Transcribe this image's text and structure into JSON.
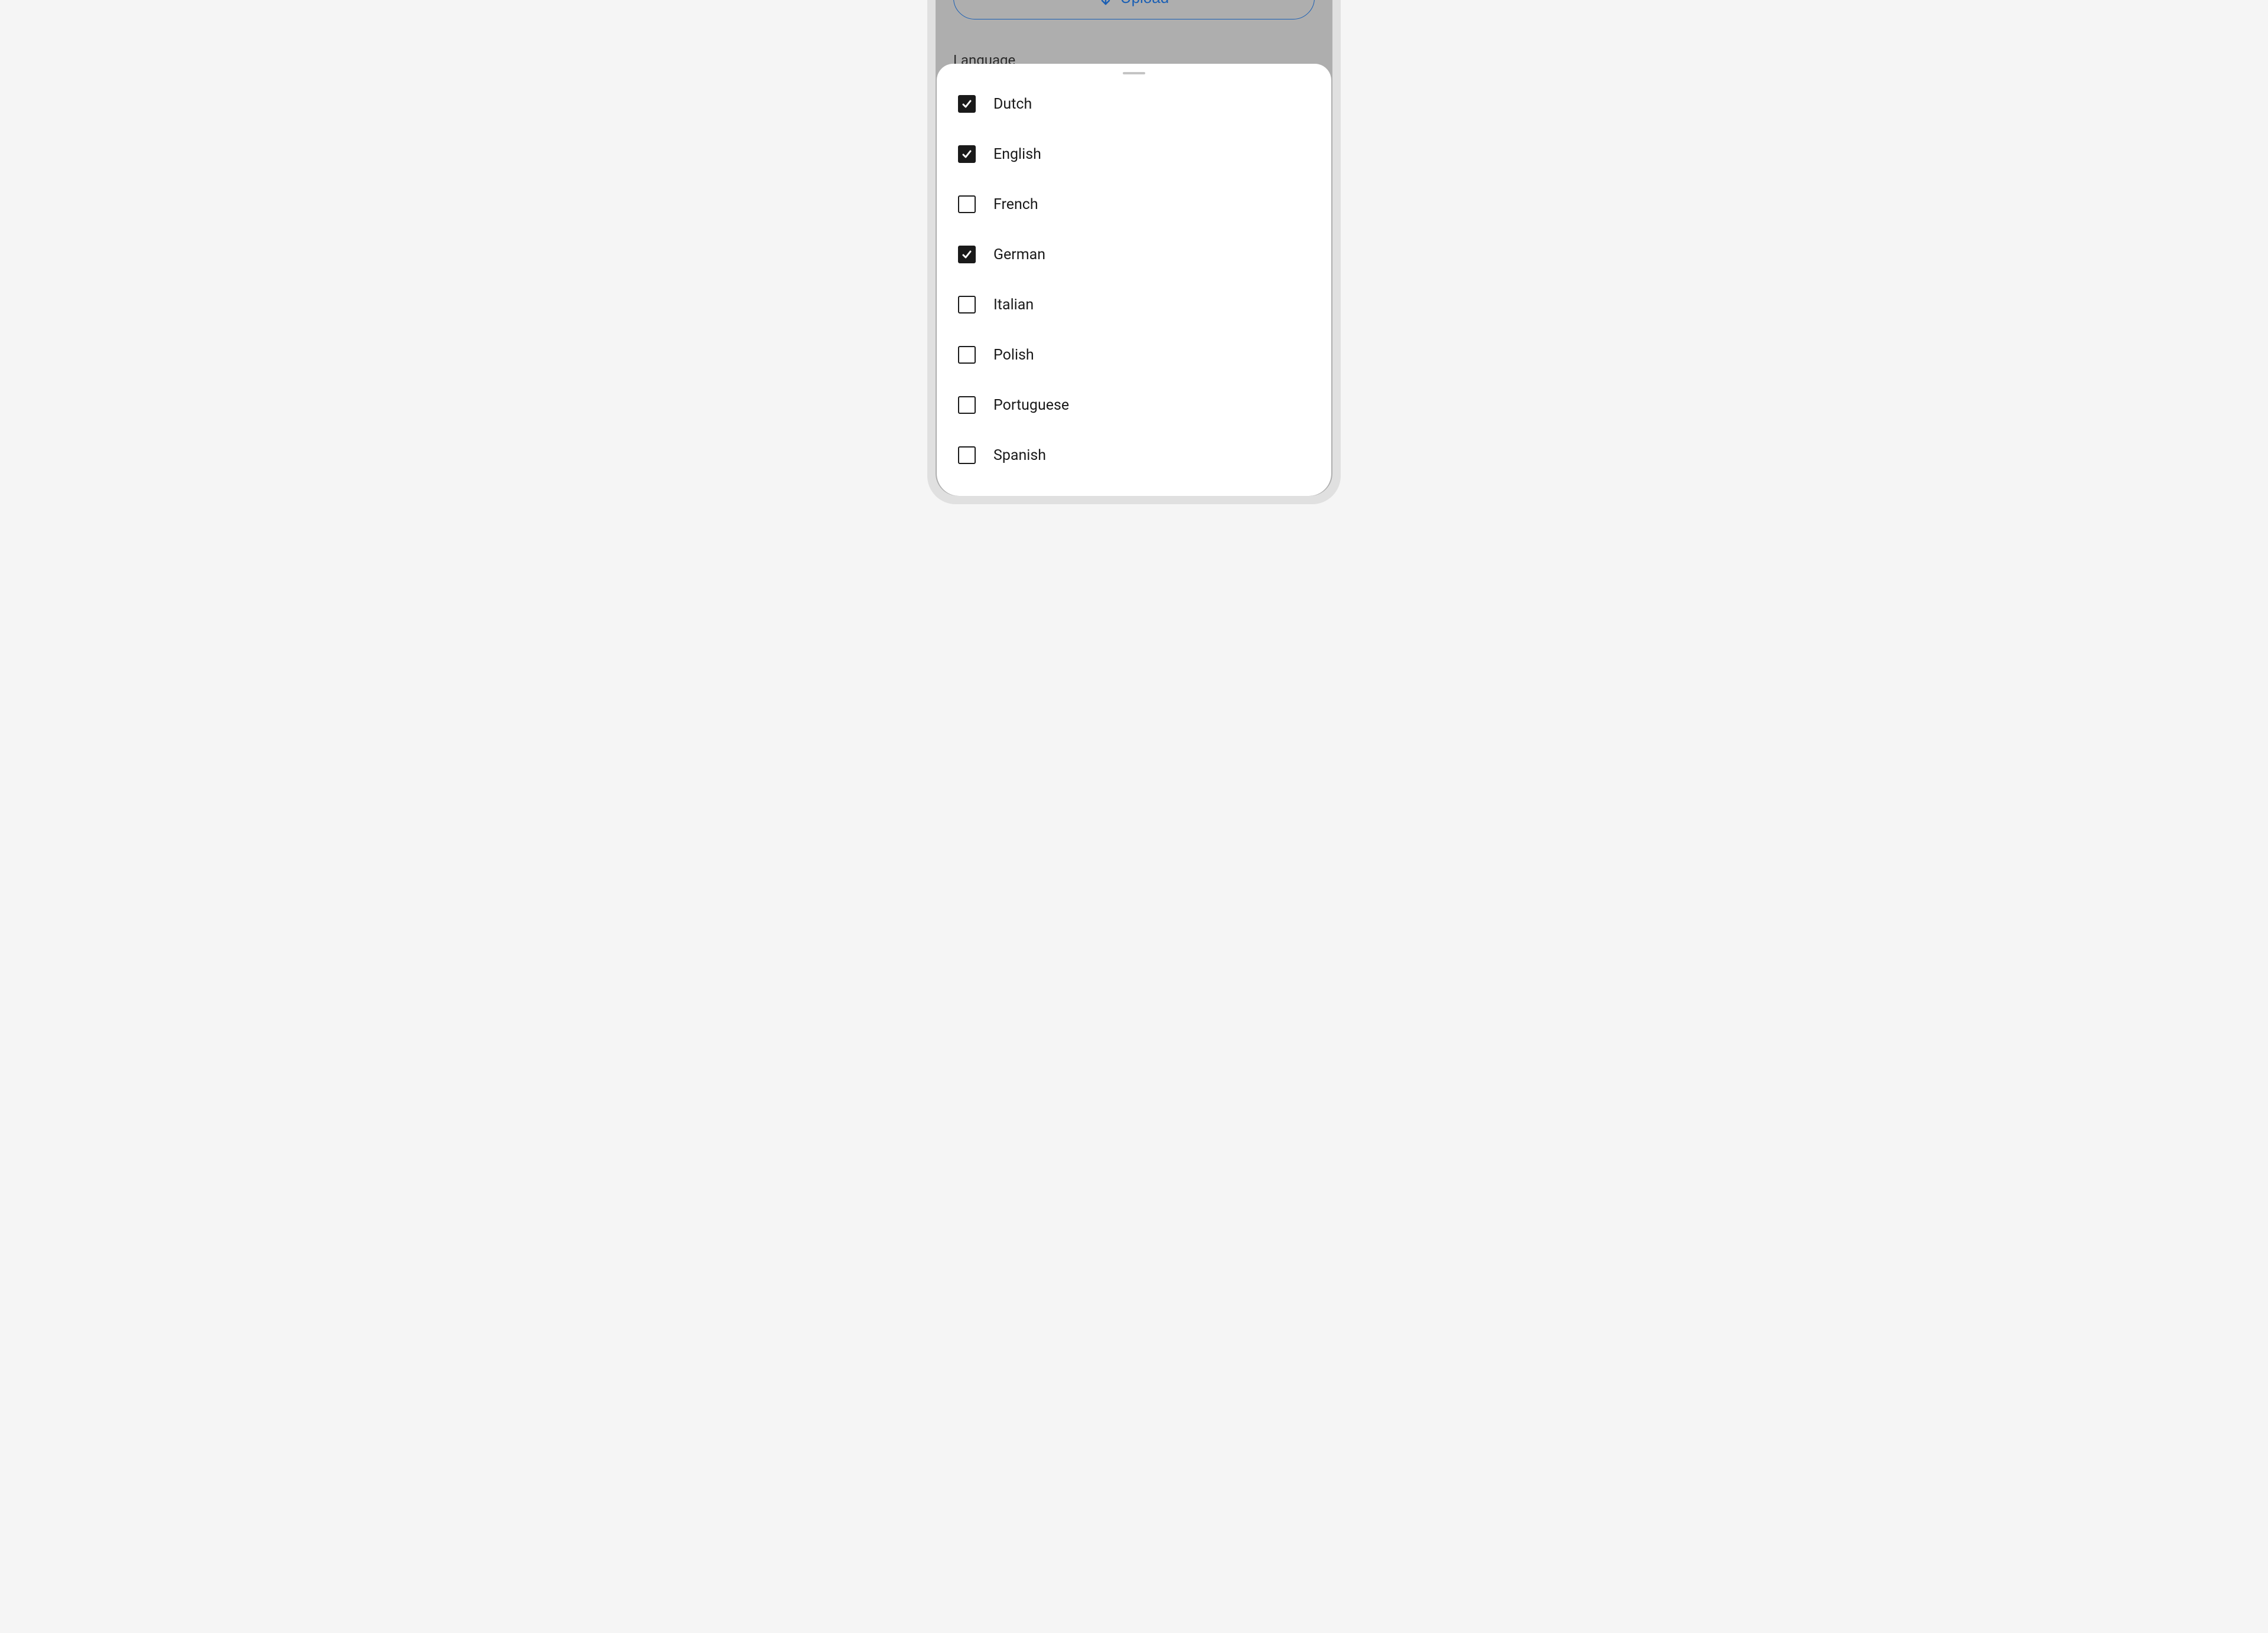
{
  "upload": {
    "label": "Upload"
  },
  "section": {
    "language_heading": "Language"
  },
  "languages": [
    {
      "name": "Dutch",
      "checked": true
    },
    {
      "name": "English",
      "checked": true
    },
    {
      "name": "French",
      "checked": false
    },
    {
      "name": "German",
      "checked": true
    },
    {
      "name": "Italian",
      "checked": false
    },
    {
      "name": "Polish",
      "checked": false
    },
    {
      "name": "Portuguese",
      "checked": false
    },
    {
      "name": "Spanish",
      "checked": false
    }
  ]
}
